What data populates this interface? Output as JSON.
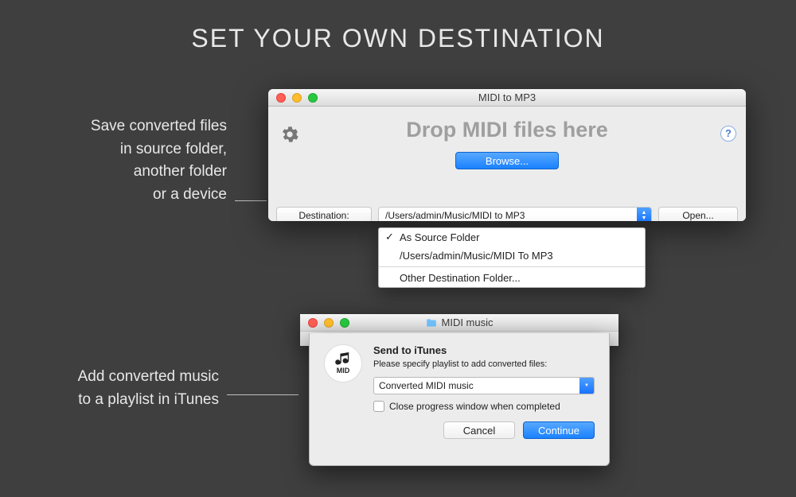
{
  "headline": "SET YOUR OWN DESTINATION",
  "caption1": {
    "line1": "Save converted files",
    "line2": "in source folder,",
    "line3": "another folder",
    "line4": "or a device"
  },
  "caption2": {
    "line1": "Add converted music",
    "line2": "to a playlist in iTunes"
  },
  "mainWindow": {
    "title": "MIDI to MP3",
    "dropzone": "Drop MIDI files here",
    "browse": "Browse...",
    "destinationLabel": "Destination:",
    "destinationPath": "/Users/admin/Music/MIDI to MP3",
    "open": "Open..."
  },
  "menu": {
    "item1": "As Source Folder",
    "item2": "/Users/admin/Music/MIDI To MP3",
    "item3": "Other Destination Folder..."
  },
  "dialogWindow": {
    "title": "MIDI music",
    "sheetTitle": "Send to iTunes",
    "sheetText": "Please specify playlist to add converted files:",
    "playlistName": "Converted MIDI music",
    "checkboxLabel": "Close progress window when completed",
    "cancel": "Cancel",
    "continue": "Continue",
    "midBadge": "MID"
  }
}
